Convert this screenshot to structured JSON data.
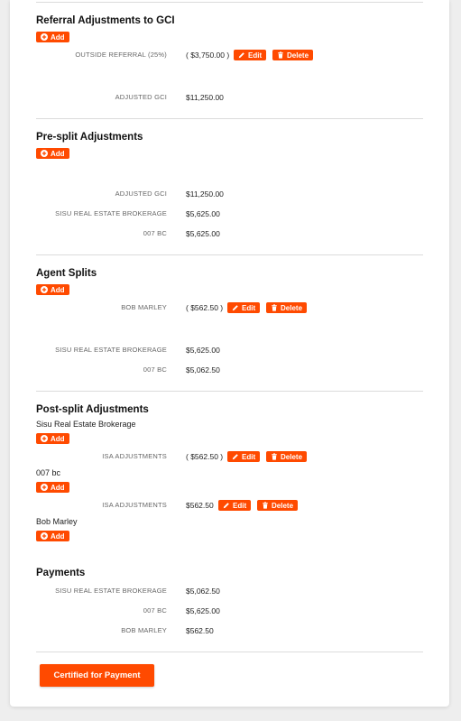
{
  "colors": {
    "accent": "#ff4a00",
    "divider": "#dcdcdc"
  },
  "icons": {
    "add": "plus-circle-icon",
    "edit": "pencil-icon",
    "delete": "trash-icon"
  },
  "buttons": {
    "add": "Add",
    "edit": "Edit",
    "delete": "Delete"
  },
  "referral": {
    "title": "Referral Adjustments to GCI",
    "rows": [
      {
        "label": "OUTSIDE REFERRAL (25%)",
        "value": "( $3,750.00 )"
      },
      {
        "label": "ADJUSTED GCI",
        "value": "$11,250.00"
      }
    ]
  },
  "presplit": {
    "title": "Pre-split Adjustments",
    "rows": [
      {
        "label": "ADJUSTED GCI",
        "value": "$11,250.00"
      },
      {
        "label": "SISU REAL ESTATE BROKERAGE",
        "value": "$5,625.00"
      },
      {
        "label": "007 BC",
        "value": "$5,625.00"
      }
    ]
  },
  "agentsplits": {
    "title": "Agent Splits",
    "rows": [
      {
        "label": "BOB MARLEY",
        "value": "( $562.50 )"
      },
      {
        "label": "SISU REAL ESTATE BROKERAGE",
        "value": "$5,625.00"
      },
      {
        "label": "007 BC",
        "value": "$5,062.50"
      }
    ]
  },
  "postsplit": {
    "title": "Post-split Adjustments",
    "groups": [
      {
        "name": "Sisu Real Estate Brokerage",
        "row": {
          "label": "ISA ADJUSTMENTS",
          "value": "( $562.50 )"
        }
      },
      {
        "name": "007 bc",
        "row": {
          "label": "ISA ADJUSTMENTS",
          "value": "$562.50"
        }
      },
      {
        "name": "Bob Marley"
      }
    ]
  },
  "payments": {
    "title": "Payments",
    "rows": [
      {
        "label": "SISU REAL ESTATE BROKERAGE",
        "value": "$5,062.50"
      },
      {
        "label": "007 BC",
        "value": "$5,625.00"
      },
      {
        "label": "BOB MARLEY",
        "value": "$562.50"
      }
    ]
  },
  "certify_label": "Certified for Payment"
}
